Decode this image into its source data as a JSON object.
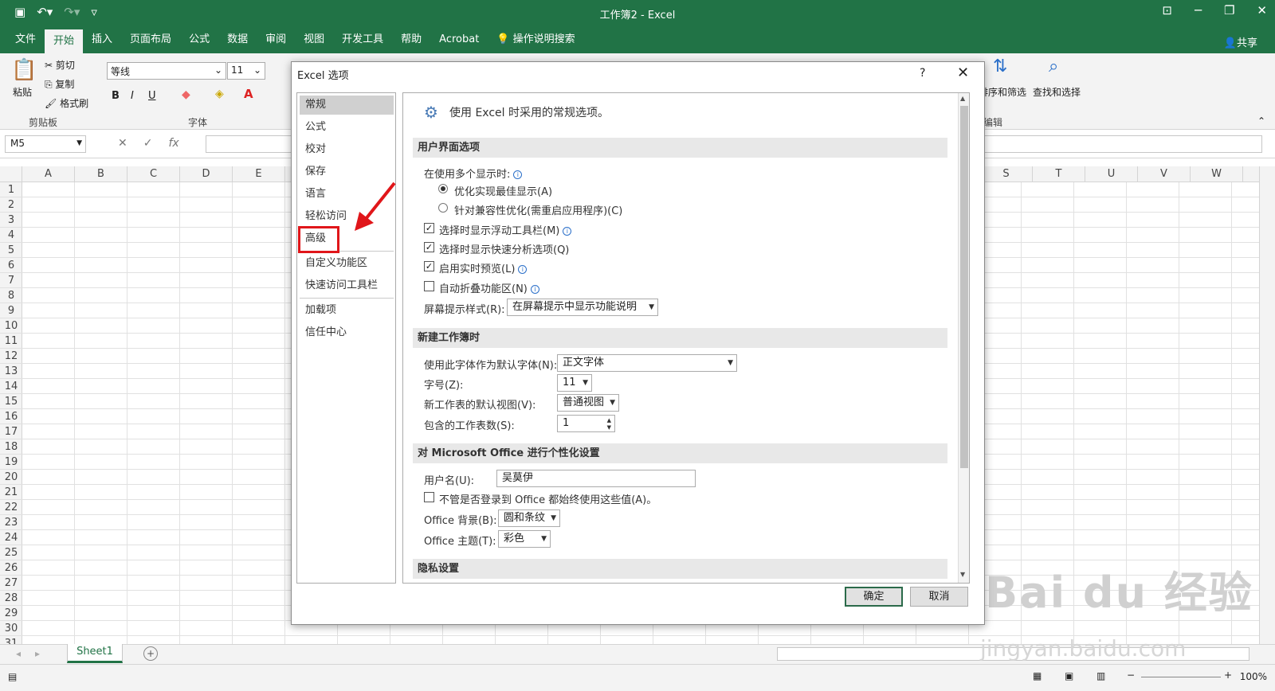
{
  "window": {
    "title": "工作簿2 - Excel"
  },
  "ribbon_tabs": [
    "文件",
    "开始",
    "插入",
    "页面布局",
    "公式",
    "数据",
    "审阅",
    "视图",
    "开发工具",
    "帮助",
    "Acrobat"
  ],
  "tell_me": "操作说明搜索",
  "share": "共享",
  "clipboard": {
    "paste": "粘贴",
    "cut": "剪切",
    "copy": "复制",
    "format_painter": "格式刷",
    "group": "剪贴板"
  },
  "font": {
    "name": "等线",
    "size": "11",
    "group": "字体",
    "bold": "B",
    "italic": "I",
    "underline": "U"
  },
  "editing": {
    "sort_filter": "排序和筛选",
    "find_select": "查找和选择",
    "group": "编辑"
  },
  "formula_bar": {
    "name_box": "M5",
    "fx": "fx"
  },
  "columns_left": [
    "A",
    "B",
    "C",
    "D",
    "E"
  ],
  "columns_right": [
    "S",
    "T",
    "U",
    "V",
    "W"
  ],
  "rows": [
    "1",
    "2",
    "3",
    "4",
    "5",
    "6",
    "7",
    "8",
    "9",
    "10",
    "11",
    "12",
    "13",
    "14",
    "15",
    "16",
    "17",
    "18",
    "19",
    "20",
    "21",
    "22",
    "23",
    "24",
    "25",
    "26",
    "27",
    "28",
    "29",
    "30",
    "31"
  ],
  "sheet_tab": "Sheet1",
  "zoom": "100%",
  "watermark": {
    "logo": "Bai du 经验",
    "url": "jingyan.baidu.com"
  },
  "dialog": {
    "title": "Excel 选项",
    "help": "?",
    "nav": [
      "常规",
      "公式",
      "校对",
      "保存",
      "语言",
      "轻松访问",
      "高级",
      "自定义功能区",
      "快速访问工具栏",
      "加载项",
      "信任中心"
    ],
    "header": "使用 Excel 时采用的常规选项。",
    "sec_ui": "用户界面选项",
    "multi_display": "在使用多个显示时:",
    "radio_best": "优化实现最佳显示(A)",
    "radio_compat": "针对兼容性优化(需重启应用程序)(C)",
    "chk_mini_toolbar": "选择时显示浮动工具栏(M)",
    "chk_quick_analysis": "选择时显示快速分析选项(Q)",
    "chk_live_preview": "启用实时预览(L)",
    "chk_collapse_ribbon": "自动折叠功能区(N)",
    "tooltip_style_label": "屏幕提示样式(R):",
    "tooltip_style_value": "在屏幕提示中显示功能说明",
    "sec_new_wb": "新建工作簿时",
    "default_font_label": "使用此字体作为默认字体(N):",
    "default_font_value": "正文字体",
    "font_size_label": "字号(Z):",
    "font_size_value": "11",
    "default_view_label": "新工作表的默认视图(V):",
    "default_view_value": "普通视图",
    "sheet_count_label": "包含的工作表数(S):",
    "sheet_count_value": "1",
    "sec_personalize": "对 Microsoft Office 进行个性化设置",
    "username_label": "用户名(U):",
    "username_value": "吴莫伊",
    "chk_always_use": "不管是否登录到 Office 都始终使用这些值(A)。",
    "office_bg_label": "Office 背景(B):",
    "office_bg_value": "圆和条纹",
    "office_theme_label": "Office 主题(T):",
    "office_theme_value": "彩色",
    "sec_privacy": "隐私设置",
    "ok": "确定",
    "cancel": "取消"
  },
  "colors": {
    "excel_green": "#217346",
    "highlight_red": "#e0161a"
  }
}
